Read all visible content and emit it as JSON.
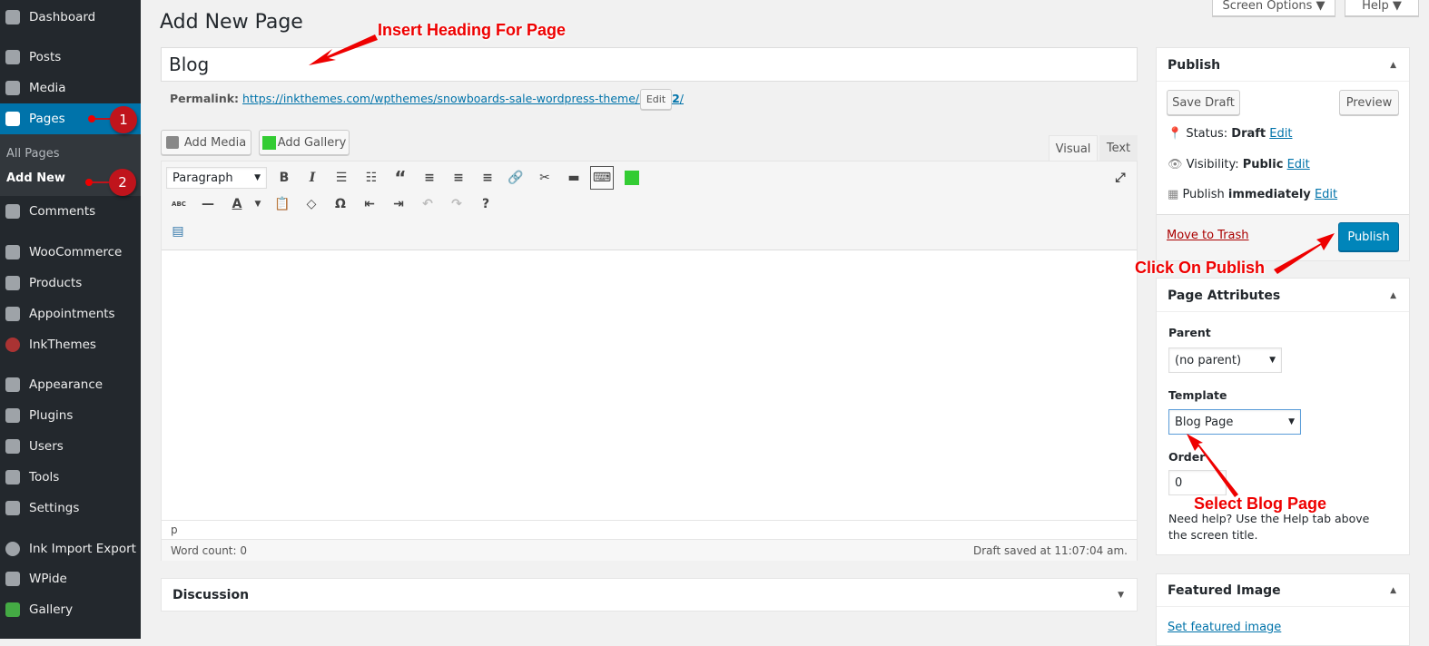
{
  "sidebar": {
    "items": [
      {
        "label": "Dashboard",
        "icon": "dashboard-icon"
      },
      {
        "label": "Posts",
        "icon": "pin-icon"
      },
      {
        "label": "Media",
        "icon": "media-icon"
      },
      {
        "label": "Pages",
        "icon": "pages-icon"
      },
      {
        "label": "Comments",
        "icon": "comment-icon"
      },
      {
        "label": "WooCommerce",
        "icon": "woocommerce-icon"
      },
      {
        "label": "Products",
        "icon": "box-icon"
      },
      {
        "label": "Appointments",
        "icon": "appointments-icon"
      },
      {
        "label": "InkThemes",
        "icon": "inkthemes-icon"
      },
      {
        "label": "Appearance",
        "icon": "brush-icon"
      },
      {
        "label": "Plugins",
        "icon": "plugin-icon"
      },
      {
        "label": "Users",
        "icon": "user-icon"
      },
      {
        "label": "Tools",
        "icon": "wrench-icon"
      },
      {
        "label": "Settings",
        "icon": "settings-icon"
      },
      {
        "label": "Ink Import Export",
        "icon": "gear-icon"
      },
      {
        "label": "WPide",
        "icon": "code-icon"
      },
      {
        "label": "Gallery",
        "icon": "gallery-icon"
      }
    ],
    "submenu": [
      "All Pages",
      "Add New"
    ]
  },
  "header": {
    "screen_options": "Screen Options ▼",
    "help": "Help ▼",
    "title": "Add New Page"
  },
  "editor": {
    "title_value": "Blog",
    "permalink_label": "Permalink:",
    "permalink_url": "https://inkthemes.com/wpthemes/snowboards-sale-wordpress-theme/",
    "permalink_slug": "blog-2",
    "permalink_end": "/",
    "edit": "Edit",
    "add_media": "Add Media",
    "add_gallery": "Add Gallery",
    "tab_visual": "Visual",
    "tab_text": "Text",
    "format": "Paragraph",
    "path": "p",
    "word_count": "Word count: 0",
    "saved": "Draft saved at 11:07:04 am."
  },
  "discussion": {
    "title": "Discussion"
  },
  "publish": {
    "title": "Publish",
    "save_draft": "Save Draft",
    "preview": "Preview",
    "status_label": "Status:",
    "status": "Draft",
    "visibility_label": "Visibility:",
    "visibility": "Public",
    "publish_label": "Publish",
    "publish_when": "immediately",
    "edit": "Edit",
    "trash": "Move to Trash",
    "publish_btn": "Publish"
  },
  "attributes": {
    "title": "Page Attributes",
    "parent_label": "Parent",
    "parent": "(no parent)",
    "template_label": "Template",
    "template": "Blog Page",
    "order_label": "Order",
    "order": "0",
    "help": "Need help? Use the Help tab above the screen title."
  },
  "featured": {
    "title": "Featured Image",
    "link": "Set featured image"
  },
  "annotations": {
    "heading": "Insert Heading For Page",
    "publish": "Click On Publish",
    "template": "Select Blog Page",
    "step1": "1",
    "step2": "2"
  },
  "colors": {
    "accent": "#0073aa",
    "sidebar": "#23282d",
    "annotation": "#e00000"
  }
}
